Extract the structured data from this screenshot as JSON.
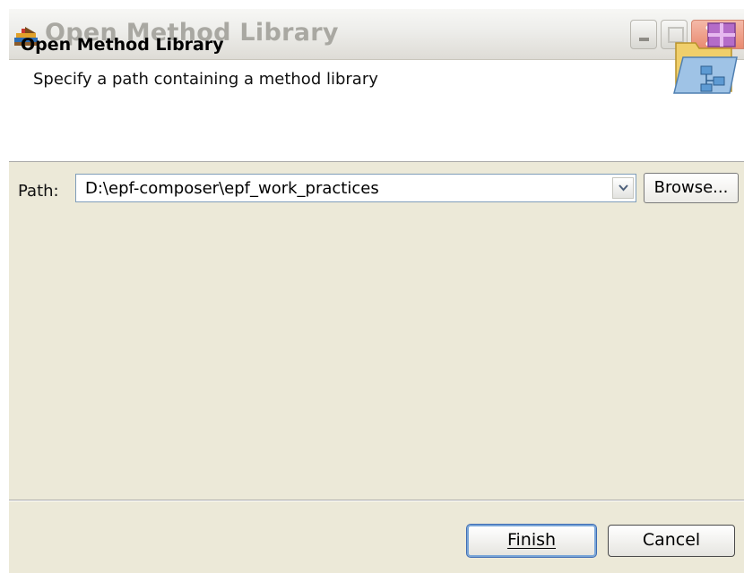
{
  "window": {
    "title": "Open Method Library",
    "title_icon": "method-library-icon"
  },
  "header": {
    "title": "Open Method Library",
    "description": "Specify a path containing a method library",
    "banner_icon": "open-library-wizard-icon"
  },
  "form": {
    "path_label": "Path:",
    "path_value": "D:\\epf-composer\\epf_work_practices",
    "browse_label": "Browse..."
  },
  "buttons": {
    "finish_label": "Finish",
    "cancel_label": "Cancel"
  },
  "colors": {
    "dialog_bg": "#ece9d8",
    "title_text": "#a9a8a2",
    "close_button": "#e98a70",
    "default_button_focus": "#7aa6d8"
  }
}
